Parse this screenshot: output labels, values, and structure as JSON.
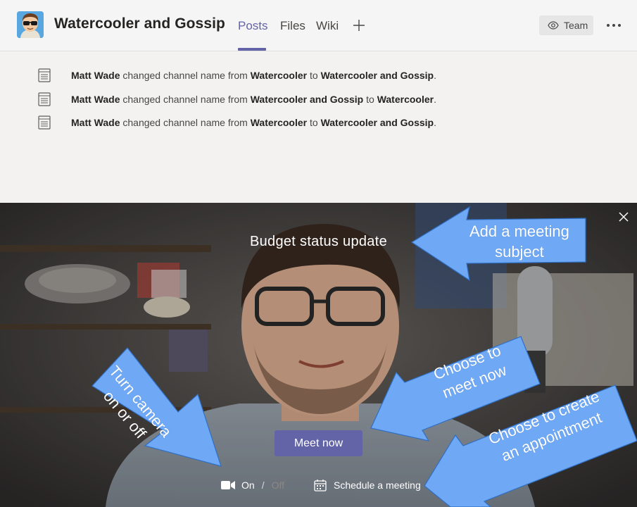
{
  "header": {
    "title": "Watercooler and Gossip",
    "tabs": [
      {
        "label": "Posts",
        "active": true
      },
      {
        "label": "Files",
        "active": false
      },
      {
        "label": "Wiki",
        "active": false
      }
    ],
    "team_button": "Team",
    "icons": {
      "add": "plus-icon",
      "more": "more-options-icon",
      "team": "eye-icon"
    }
  },
  "feed": {
    "events": [
      {
        "actor": "Matt Wade",
        "action": " changed channel name from ",
        "from": "Watercooler",
        "connector": " to ",
        "to": "Watercooler and Gossip",
        "end": "."
      },
      {
        "actor": "Matt Wade",
        "action": " changed channel name from ",
        "from": "Watercooler and Gossip",
        "connector": " to ",
        "to": "Watercooler",
        "end": "."
      },
      {
        "actor": "Matt Wade",
        "action": " changed channel name from ",
        "from": "Watercooler",
        "connector": " to ",
        "to": "Watercooler and Gossip",
        "end": "."
      }
    ]
  },
  "meeting": {
    "subject": "Budget status update",
    "meet_now_label": "Meet now",
    "camera_on_label": "On",
    "camera_separator": "/",
    "camera_off_label": "Off",
    "schedule_label": "Schedule a meeting"
  },
  "annotations": {
    "subject": "Add a meeting\nsubject",
    "meet_now": "Choose to\nmeet now",
    "appointment": "Choose to create\nan appointment",
    "camera": "Turn camera\non or off"
  },
  "colors": {
    "accent": "#6264a7",
    "annotation_fill": "#6fa8f5",
    "annotation_stroke": "#2f6fc4"
  }
}
